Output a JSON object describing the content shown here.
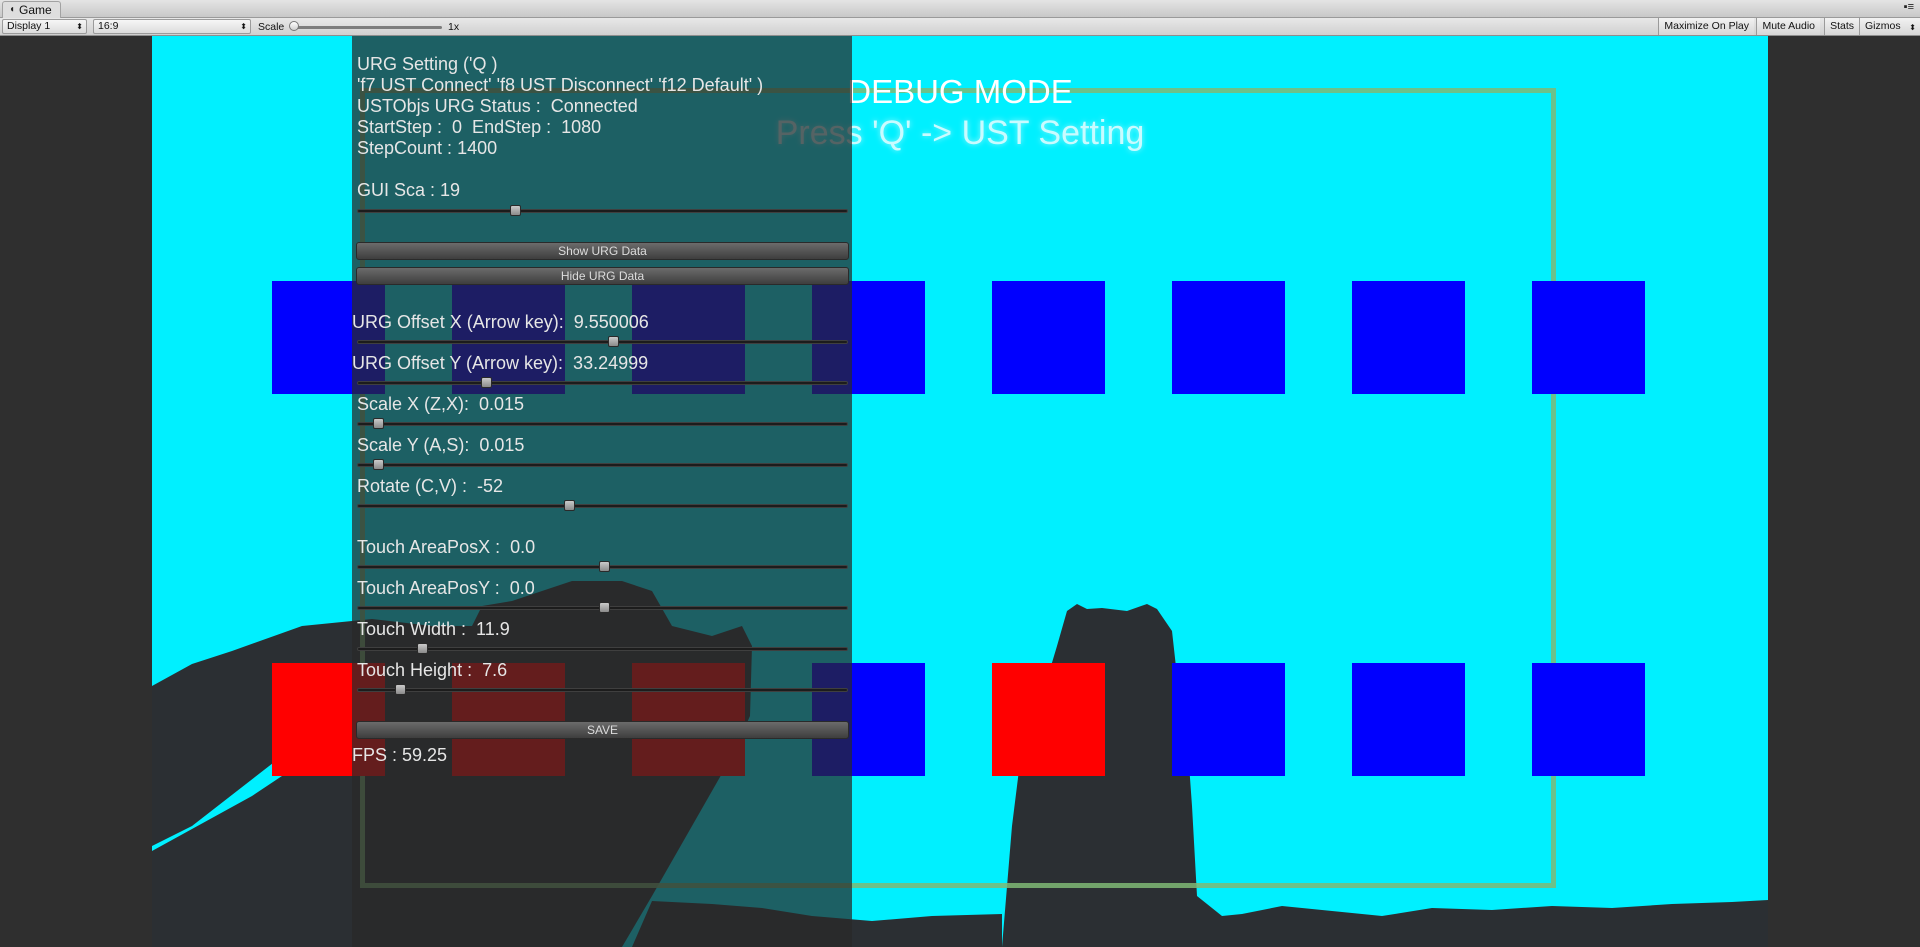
{
  "window": {
    "tab_title": "Game",
    "tab_icon": "pacman-icon",
    "tab_menu": "▪≡"
  },
  "toolbar": {
    "display_select": "Display 1",
    "aspect_select": "16:9",
    "scale_label": "Scale",
    "scale_value": "1x",
    "scale_level": 0,
    "maximize_on_play": "Maximize On Play",
    "mute_audio": "Mute Audio",
    "stats": "Stats",
    "gizmos": "Gizmos"
  },
  "game": {
    "debug_title": "DEBUG MODE",
    "debug_hint": "Press 'Q' -> UST Setting",
    "grid_colors": {
      "blue": "#0000ff",
      "red": "#ff0000",
      "background": "#00f0ff"
    },
    "top_row": [
      "blue",
      "blue",
      "blue",
      "blue",
      "blue",
      "blue",
      "blue",
      "blue"
    ],
    "bottom_row": [
      "red",
      "red",
      "red",
      "blue",
      "red",
      "blue",
      "blue",
      "blue"
    ]
  },
  "panel": {
    "title": "URG Setting ('Q )",
    "hotkeys": "'f7 UST Connect' 'f8 UST Disconnect' 'f12 Default' )",
    "status": "USTObjs URG Status :  Connected",
    "steps": "StartStep :  0  EndStep :  1080",
    "step_count": "StepCount : 1400",
    "gui_scale": {
      "label": "GUI Sca : 19",
      "level": 0.32
    },
    "show_button": "Show URG Data",
    "hide_button": "Hide URG Data",
    "offset_x": {
      "label": "URG Offset X (Arrow key):  9.550006",
      "level": 0.52
    },
    "offset_y": {
      "label": "URG Offset Y (Arrow key):  33.24999",
      "level": 0.26
    },
    "scale_x": {
      "label": "Scale X (Z,X):  0.015",
      "level": 0.04
    },
    "scale_y": {
      "label": "Scale Y (A,S):  0.015",
      "level": 0.04
    },
    "rotate": {
      "label": "Rotate (C,V) :  -52",
      "level": 0.43
    },
    "touch_pos_x": {
      "label": "Touch AreaPosX :  0.0",
      "level": 0.5
    },
    "touch_pos_y": {
      "label": "Touch AreaPosY :  0.0",
      "level": 0.5
    },
    "touch_width": {
      "label": "Touch Width :  11.9",
      "level": 0.13
    },
    "touch_height": {
      "label": "Touch Height :  7.6",
      "level": 0.085
    },
    "save_button": "SAVE",
    "fps": "FPS : 59.25"
  }
}
